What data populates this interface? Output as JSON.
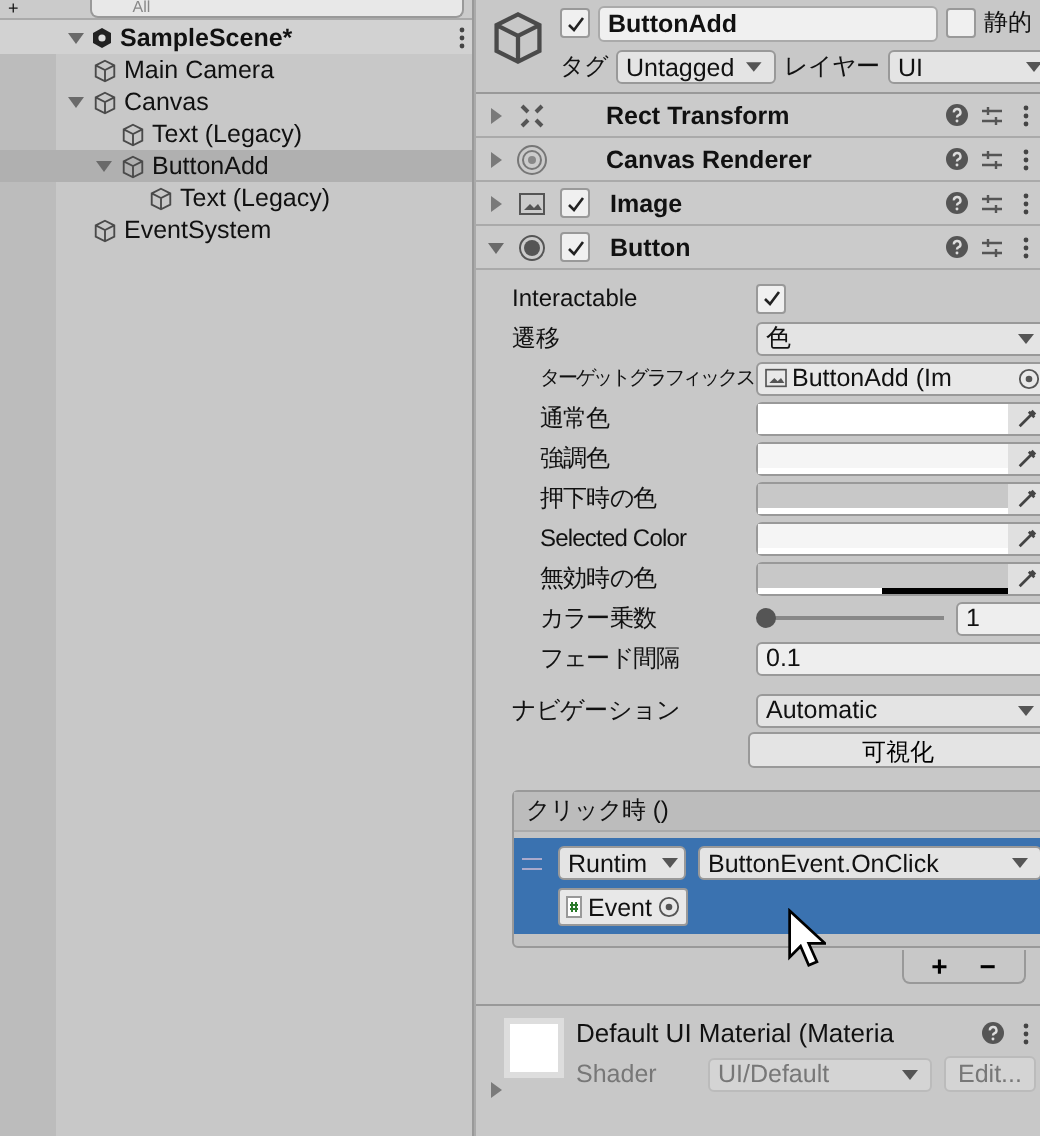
{
  "hierarchy": {
    "toolbar": {
      "add": "+",
      "search_placeholder": "All"
    },
    "scene": {
      "label": "SampleScene*",
      "expanded": true,
      "children": [
        {
          "label": "Main Camera",
          "selected": false
        },
        {
          "label": "Canvas",
          "selected": false,
          "expanded": true,
          "children": [
            {
              "label": "Text (Legacy)",
              "selected": false
            },
            {
              "label": "ButtonAdd",
              "selected": true,
              "expanded": true,
              "children": [
                {
                  "label": "Text (Legacy)",
                  "selected": false
                }
              ]
            }
          ]
        },
        {
          "label": "EventSystem",
          "selected": false
        }
      ]
    }
  },
  "inspector": {
    "object": {
      "active": true,
      "name": "ButtonAdd",
      "static": false,
      "static_label": "静的",
      "tag_label": "タグ",
      "tag": "Untagged",
      "layer_label": "レイヤー",
      "layer": "UI"
    },
    "components": [
      {
        "kind": "rect",
        "name": "Rect Transform",
        "expanded": false
      },
      {
        "kind": "renderer",
        "name": "Canvas Renderer",
        "expanded": false
      },
      {
        "kind": "image",
        "name": "Image",
        "expanded": false,
        "enabled": true
      },
      {
        "kind": "button",
        "name": "Button",
        "expanded": true,
        "enabled": true
      }
    ],
    "properties": [
      {
        "kind": "checkbox",
        "label": "Interactable",
        "checked": true,
        "indent": false
      },
      {
        "kind": "dropdown",
        "label": "遷移",
        "value": "色",
        "indent": false
      },
      {
        "kind": "object",
        "label": "ターゲットグラフィックス",
        "value": "ButtonAdd (Im",
        "indent": true
      },
      {
        "kind": "color",
        "label": "通常色",
        "color": "#ffffff",
        "level": 1,
        "indent": true
      },
      {
        "kind": "color",
        "label": "強調色",
        "color": "#f5f5f5",
        "level": 1,
        "indent": true
      },
      {
        "kind": "color",
        "label": "押下時の色",
        "color": "#c8c8c8",
        "level": 1,
        "indent": true
      },
      {
        "kind": "color",
        "label": "Selected Color",
        "color": "#f5f5f5",
        "level": 1,
        "indent": true
      },
      {
        "kind": "color",
        "label": "無効時の色",
        "color": "#c8c8c8",
        "level": 0.5,
        "indent": true
      },
      {
        "kind": "slider",
        "label": "カラー乗数",
        "level": 0,
        "value": "1",
        "indent": true
      },
      {
        "kind": "number",
        "label": "フェード間隔",
        "value": "0.1",
        "indent": true
      }
    ],
    "navigation": {
      "label": "ナビゲーション",
      "value": "Automatic",
      "visualize": "可視化"
    },
    "event": {
      "title": "クリック時 ()",
      "runtime": "Runtim",
      "function": "ButtonEvent.OnClick",
      "target": "Event",
      "add": "+",
      "remove": "−"
    },
    "material": {
      "name": "Default UI Material (Materia",
      "shader_label": "Shader",
      "shader": "UI/Default",
      "edit": "Edit..."
    }
  }
}
